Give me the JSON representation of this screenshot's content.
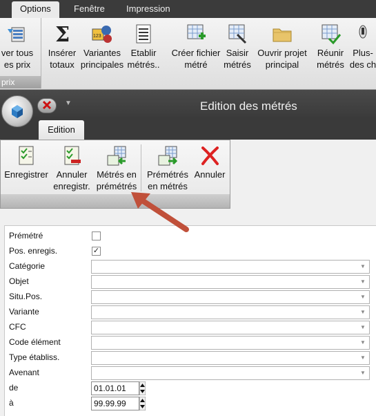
{
  "top_tabs": [
    "Options",
    "Fenêtre",
    "Impression"
  ],
  "ribbon": {
    "group1": {
      "label": "prix",
      "button": "ver tous\nes prix"
    },
    "buttons": [
      {
        "label": "Insérer\ntotaux",
        "icon": "sigma-icon"
      },
      {
        "label": "Variantes\nprincipales",
        "icon": "variants-icon"
      },
      {
        "label": "Etablir\nmétrés..",
        "icon": "list-icon"
      },
      {
        "label": "Créer fichier\nmétré",
        "icon": "create-file-icon"
      },
      {
        "label": "Saisir\nmétrés",
        "icon": "enter-measure-icon"
      },
      {
        "label": "Ouvrir projet\nprincipal",
        "icon": "folder-icon"
      },
      {
        "label": "Réunir\nmétrés",
        "icon": "merge-icon"
      },
      {
        "label": "Plus-\ndes ch",
        "icon": "more-icon"
      }
    ]
  },
  "window": {
    "title": "Edition des métrés",
    "tab": "Edition",
    "buttons": [
      {
        "label": "Enregistrer\n ",
        "icon": "save-icon"
      },
      {
        "label": "Annuler\nenregistr.",
        "icon": "cancel-save-icon"
      },
      {
        "label": "Métrés en\nprémétrés",
        "icon": "measures-to-premeasures-icon"
      },
      {
        "label": "Prémétrés\nen métrés",
        "icon": "premeasures-to-measures-icon"
      },
      {
        "label": "Annuler\n ",
        "icon": "cancel-x-icon"
      }
    ]
  },
  "form": {
    "premetre": {
      "label": "Prémétré",
      "checked": false
    },
    "pos_enregis": {
      "label": "Pos. enregis.",
      "checked": true
    },
    "categorie": "Catégorie",
    "objet": "Objet",
    "situ_pos": "Situ.Pos.",
    "variante": "Variante",
    "cfc": "CFC",
    "code_element": "Code élément",
    "type_etabliss": "Type établiss.",
    "avenant": "Avenant",
    "de": {
      "label": "de",
      "value": "01.01.01"
    },
    "a": {
      "label": "à",
      "value": "99.99.99"
    }
  },
  "colors": {
    "annotation_arrow": "#c0503a"
  }
}
